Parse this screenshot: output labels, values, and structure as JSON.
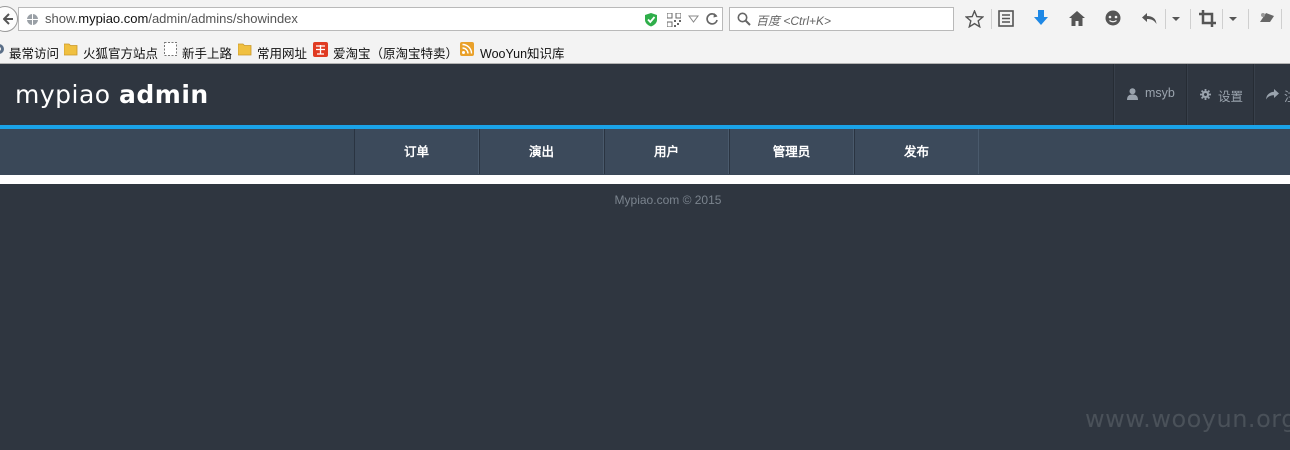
{
  "browser": {
    "url_prefix": "show.",
    "url_domain": "mypiao.com",
    "url_path": "/admin/admins/showindex",
    "search_placeholder": "百度 <Ctrl+K>"
  },
  "bookmarks": [
    {
      "label": "最常访问",
      "icon": "gear-icon"
    },
    {
      "label": "火狐官方站点",
      "icon": "folder-icon"
    },
    {
      "label": "新手上路",
      "icon": "page-icon"
    },
    {
      "label": "常用网址",
      "icon": "folder-icon"
    },
    {
      "label": "爱淘宝（原淘宝特卖）",
      "icon": "taobao-icon"
    },
    {
      "label": "WooYun知识库",
      "icon": "rss-icon"
    }
  ],
  "site": {
    "logo_light": "mypiao",
    "logo_bold": "admin",
    "user_label": "msyb",
    "settings_label": "设置",
    "logout_label": "注",
    "nav": [
      "订单",
      "演出",
      "用户",
      "管理员",
      "发布"
    ],
    "footer": "Mypiao.com © 2015",
    "watermark": "www.wooyun.org"
  },
  "colors": {
    "header_bg": "#2f3640",
    "accent": "#1aa3e8",
    "nav_bg": "#3c4a5b"
  }
}
